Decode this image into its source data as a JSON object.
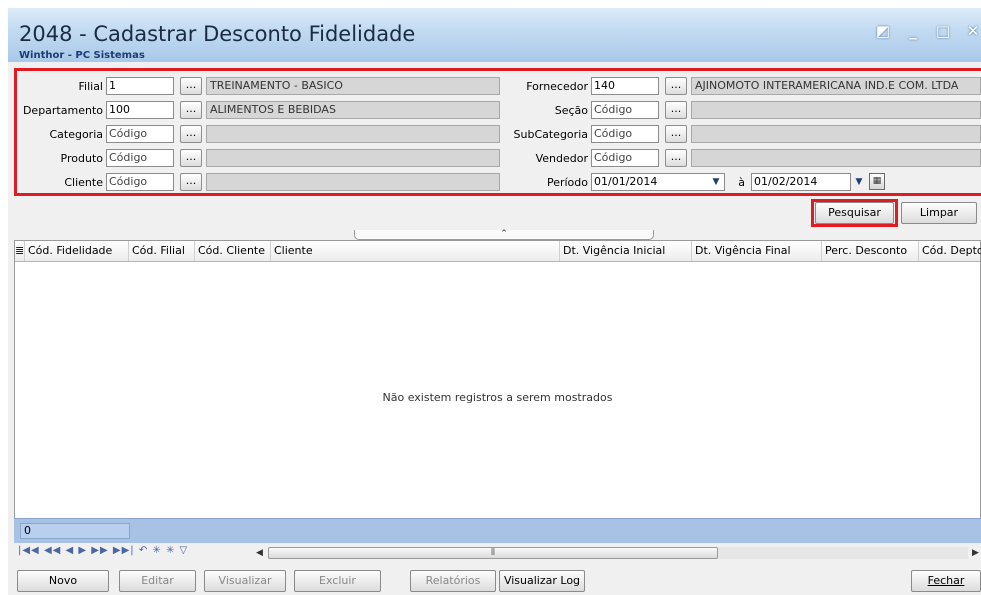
{
  "window": {
    "title": "2048 - Cadastrar Desconto Fidelidade",
    "subtitle": "Winthor - PC Sistemas"
  },
  "filters": {
    "filial": {
      "label": "Filial",
      "value": "1",
      "description": "TREINAMENTO - BASICO"
    },
    "departamento": {
      "label": "Departamento",
      "value": "100",
      "description": "ALIMENTOS E BEBIDAS"
    },
    "categoria": {
      "label": "Categoria",
      "placeholder": "Código",
      "description": ""
    },
    "produto": {
      "label": "Produto",
      "placeholder": "Código",
      "description": ""
    },
    "cliente": {
      "label": "Cliente",
      "placeholder": "Código",
      "description": ""
    },
    "fornecedor": {
      "label": "Fornecedor",
      "value": "140",
      "description": "AJINOMOTO INTERAMERICANA IND.E COM. LTDA"
    },
    "secao": {
      "label": "Seção",
      "placeholder": "Código",
      "description": ""
    },
    "subcategoria": {
      "label": "SubCategoria",
      "placeholder": "Código",
      "description": ""
    },
    "vendedor": {
      "label": "Vendedor",
      "placeholder": "Código",
      "description": ""
    },
    "periodo": {
      "label": "Período",
      "start": "01/01/2014",
      "separator": "à",
      "end": "01/02/2014"
    },
    "lookup_button_label": "..."
  },
  "actions": {
    "pesquisar": "Pesquisar",
    "limpar": "Limpar"
  },
  "grid": {
    "columns": [
      "Cód. Fidelidade",
      "Cód. Filial",
      "Cód. Cliente",
      "Cliente",
      "Dt. Vigência Inicial",
      "Dt. Vigência Final",
      "Perc. Desconto",
      "Cód. Depto"
    ],
    "empty_message": "Não existem registros a serem mostrados",
    "record_count": "0"
  },
  "bottom_buttons": {
    "novo": "Novo",
    "editar": "Editar",
    "visualizar": "Visualizar",
    "excluir": "Excluir",
    "relatorios": "Relatórios",
    "visualizar_log": "Visualizar Log",
    "fechar": "Fechar"
  },
  "colors": {
    "highlight_red": "#e11b22",
    "titlebar_blue": "#c3dbf2",
    "footer_blue": "#a8c2e6"
  }
}
